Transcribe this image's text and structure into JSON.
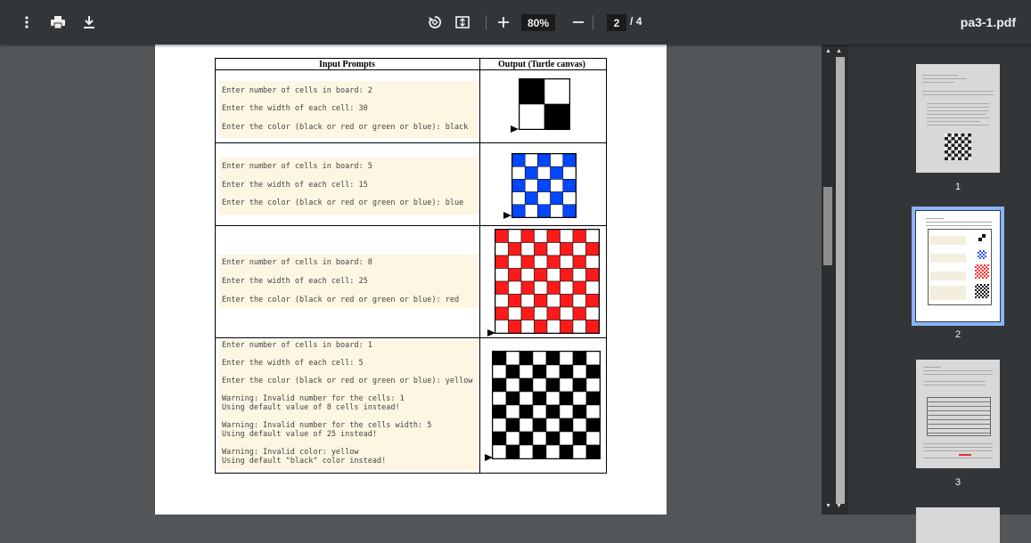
{
  "toolbar": {
    "zoom": "80%",
    "current_page": "2",
    "page_separator": "/",
    "total_pages": "4",
    "file_name": "pa3-1.pdf"
  },
  "document": {
    "col_input": "Input Prompts",
    "col_output": "Output (Turtle canvas)",
    "rows": [
      {
        "lines": [
          "Enter number of cells in board: 2",
          "Enter the width of each cell: 30",
          "Enter the color (black or red or green or blue): black"
        ],
        "board_cells": 2,
        "board_color": "#000000"
      },
      {
        "lines": [
          "Enter number of cells in board: 5",
          "Enter the width of each cell: 15",
          "Enter the color (black or red or green or blue): blue"
        ],
        "board_cells": 5,
        "board_color": "#0047ff"
      },
      {
        "lines": [
          "Enter number of cells in board: 8",
          "Enter the width of each cell: 25",
          "Enter the color (black or red or green or blue): red"
        ],
        "board_cells": 8,
        "board_color": "#ff1a1a"
      },
      {
        "lines": [
          "Enter number of cells in board: 1",
          "Enter the width of each cell: 5",
          "Enter the color (black or red or green or blue): yellow",
          "Warning: Invalid number for the cells: 1\nUsing default value of 8 cells instead!",
          "Warning: Invalid number for the cells width: 5\nUsing default value of 25 instead!",
          "Warning: Invalid color: yellow\nUsing default \"black\" color instead!"
        ],
        "board_cells": 8,
        "board_color": "#000000"
      }
    ]
  },
  "thumbnails": [
    {
      "label": "1"
    },
    {
      "label": "2"
    },
    {
      "label": "3"
    }
  ],
  "icons": {
    "menu": "more-vert-icon",
    "print": "print-icon",
    "download": "download-icon",
    "rotate": "rotate-icon",
    "fit": "fit-page-icon",
    "zoom_in": "zoom-in-icon",
    "zoom_out": "zoom-out-icon"
  }
}
